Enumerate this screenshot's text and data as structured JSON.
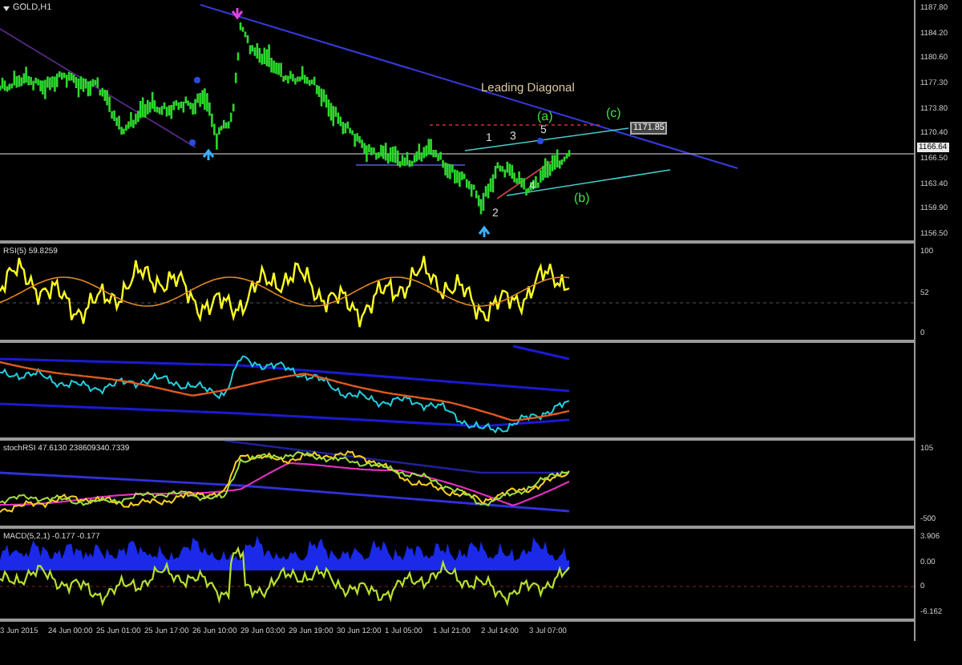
{
  "symbol": "GOLD,H1",
  "main_chart": {
    "annotations": [
      {
        "kind": "title",
        "text": "Leading Diagonal"
      },
      {
        "kind": "wave",
        "text": "(a)"
      },
      {
        "kind": "wave",
        "text": "(b)"
      },
      {
        "kind": "wave",
        "text": "(c)"
      },
      {
        "kind": "count",
        "text": "1"
      },
      {
        "kind": "count",
        "text": "2"
      },
      {
        "kind": "count",
        "text": "3"
      },
      {
        "kind": "count",
        "text": "4"
      },
      {
        "kind": "count",
        "text": "5"
      }
    ],
    "level_tag": "1171.85",
    "price_axis": [
      "1187.80",
      "1184.20",
      "1180.60",
      "1177.30",
      "1173.80",
      "1170.40",
      "1166.50",
      "1163.40",
      "1159.90",
      "1156.50"
    ],
    "current_price": "1166.64"
  },
  "panels": [
    {
      "kind": "rsi",
      "label": "RSI(5) 59.8259",
      "axis": [
        "100",
        "52",
        "0"
      ]
    },
    {
      "kind": "bands"
    },
    {
      "kind": "stoch",
      "label": "stochRSI 47.6130 238609340.7339",
      "axis": [
        "105",
        "-500"
      ]
    },
    {
      "kind": "macd",
      "label": "MACD(5,2,1) -0.177 -0.177",
      "axis": [
        "3.906",
        "0.00",
        "0",
        "-6.162"
      ]
    }
  ],
  "time_axis": [
    "3 Jun 2015",
    "24 Jun 00:00",
    "25 Jun 01:00",
    "25 Jun 17:00",
    "26 Jun 10:00",
    "29 Jun 03:00",
    "29 Jun 19:00",
    "30 Jun 12:00",
    "1 Jul 05:00",
    "1 Jul 21:00",
    "2 Jul 14:00",
    "3 Jul 07:00"
  ]
}
